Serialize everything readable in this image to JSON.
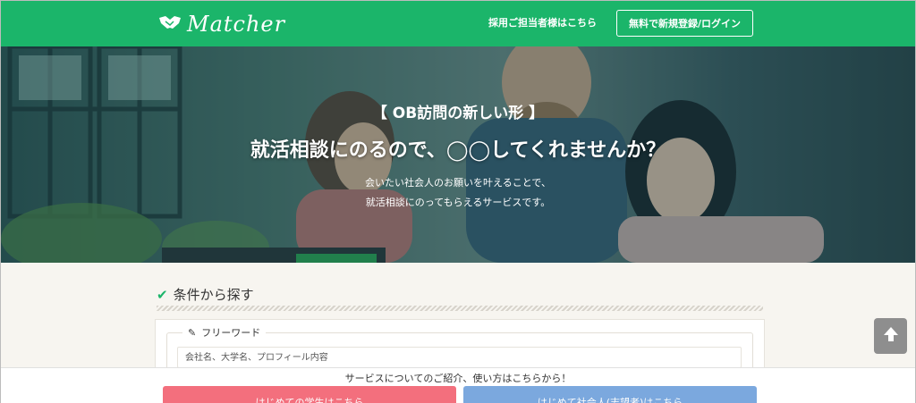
{
  "header": {
    "logo_text": "Matcher",
    "recruit_link": "採用ご担当者様はこちら",
    "signup_button": "無料で新規登録/ログイン"
  },
  "hero": {
    "tag": "【 OB訪問の新しい形 】",
    "title": "就活相談にのるので、◯◯してくれませんか？",
    "subtitle_line1": "会いたい社会人のお願いを叶えることで、",
    "subtitle_line2": "就活相談にのってもらえるサービスです。"
  },
  "search": {
    "section_title": "条件から探す",
    "freeword_label": "フリーワード",
    "placeholder": "会社名、大学名、プロフィール内容"
  },
  "bottom_bar": {
    "intro_text": "サービスについてのご紹介、使い方はこちらから！",
    "student_button": "はじめての学生はこちら",
    "working_button": "はじめて社会人(志望者)はこちら"
  },
  "colors": {
    "brand_green": "#1bb56a",
    "student_pink": "#f36f7d",
    "working_blue": "#7ba8de"
  }
}
